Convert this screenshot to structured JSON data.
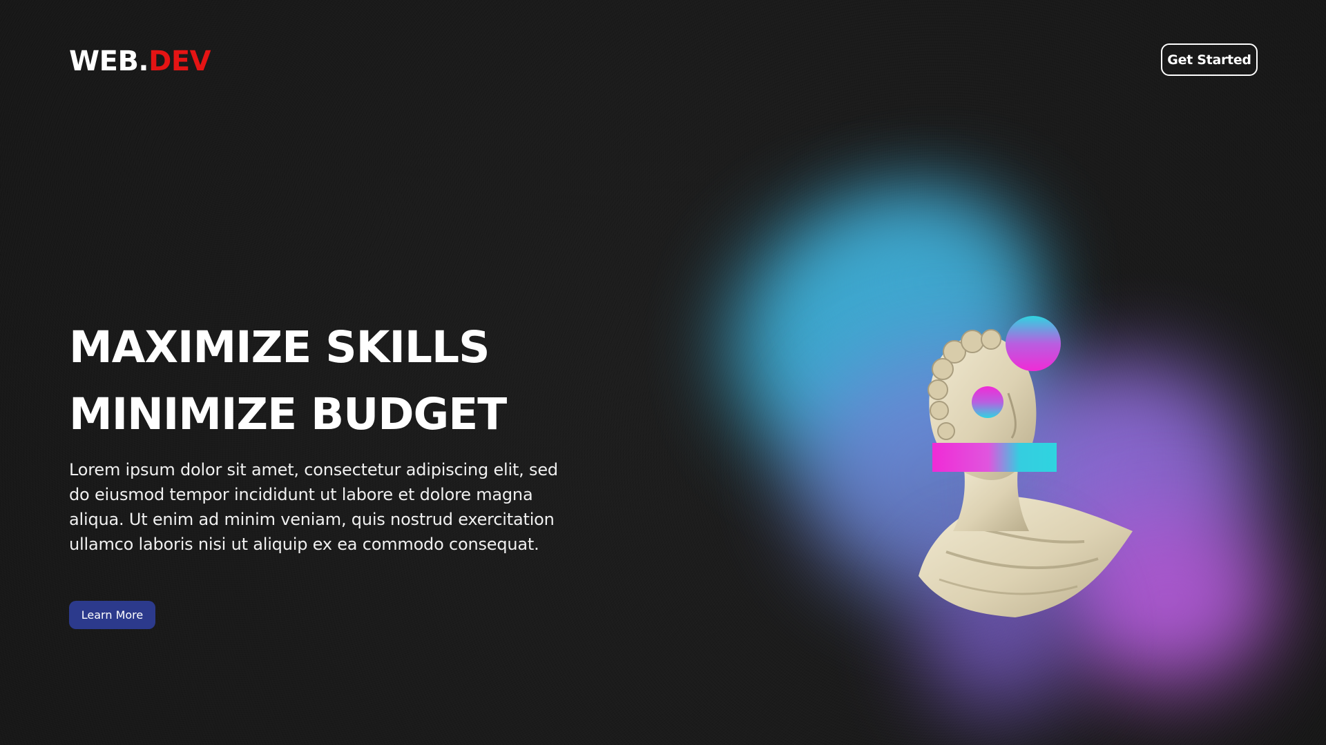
{
  "header": {
    "logo_main": "WEB.",
    "logo_accent": "DEV",
    "cta_label": "Get Started"
  },
  "hero": {
    "headline_line1": "MAXIMIZE SKILLS",
    "headline_line2": "MINIMIZE BUDGET",
    "body": "Lorem ipsum dolor sit amet, consectetur adipiscing elit, sed do eiusmod tempor incididunt ut labore et dolore magna aliqua. Ut enim ad minim veniam, quis nostrud exercitation ullamco laboris nisi ut aliquip ex ea commodo consequat.",
    "button_label": "Learn More"
  },
  "colors": {
    "background": "#1a1a1a",
    "logo_accent": "#e51414",
    "button_primary": "#2c3a8c",
    "blob_cyan": "#3fb0d8",
    "blob_violet": "#9b5fd6",
    "shape_gradient_start": "#f02bd6",
    "shape_gradient_end": "#2fd4e0",
    "statue": "#e6dcbe"
  },
  "icons": {
    "hero_art": "statue-bust-illustration"
  }
}
